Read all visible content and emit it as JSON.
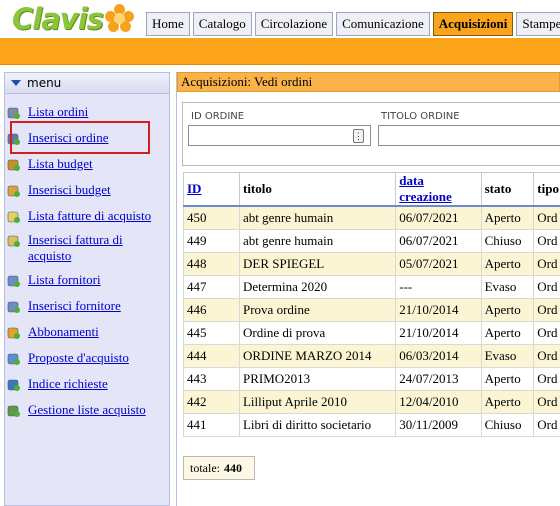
{
  "app": {
    "logo_text": "Clavis"
  },
  "topnav": {
    "tabs": [
      {
        "label": "Home",
        "active": false
      },
      {
        "label": "Catalogo",
        "active": false
      },
      {
        "label": "Circolazione",
        "active": false
      },
      {
        "label": "Comunicazione",
        "active": false
      },
      {
        "label": "Acquisizioni",
        "active": true
      },
      {
        "label": "Stampe",
        "active": false
      }
    ]
  },
  "sidebar": {
    "title": "menu",
    "items": [
      {
        "label": "Lista ordini",
        "icon": "order-list-icon"
      },
      {
        "label": "Inserisci ordine",
        "icon": "add-order-icon"
      },
      {
        "label": "Lista budget",
        "icon": "budget-bag-icon"
      },
      {
        "label": "Inserisci budget",
        "icon": "add-budget-icon"
      },
      {
        "label": "Lista fatture di acquisto",
        "icon": "invoice-list-icon"
      },
      {
        "label": "Inserisci fattura di acquisto",
        "icon": "add-invoice-icon"
      },
      {
        "label": "Lista fornitori",
        "icon": "suppliers-icon"
      },
      {
        "label": "Inserisci fornitore",
        "icon": "add-supplier-icon"
      },
      {
        "label": "Abbonamenti",
        "icon": "subscription-box-icon"
      },
      {
        "label": "Proposte d'acquisto",
        "icon": "purchase-proposal-icon"
      },
      {
        "label": "Indice richieste",
        "icon": "requests-chart-icon"
      },
      {
        "label": "Gestione liste acquisto",
        "icon": "purchase-lists-icon"
      }
    ]
  },
  "main": {
    "title": "Acquisizioni: Vedi ordini",
    "filters": {
      "id_label": "ID ORDINE",
      "id_value": "",
      "title_label": "TITOLO ORDINE",
      "title_value": ""
    },
    "table": {
      "columns": [
        "ID",
        "titolo",
        "data creazione",
        "stato",
        "tipo"
      ],
      "rows": [
        [
          "450",
          "abt genre humain",
          "06/07/2021",
          "Aperto",
          "Ord"
        ],
        [
          "449",
          "abt genre humain",
          "06/07/2021",
          "Chiuso",
          "Ord"
        ],
        [
          "448",
          "DER SPIEGEL",
          "05/07/2021",
          "Aperto",
          "Ord"
        ],
        [
          "447",
          "Determina 2020",
          "---",
          "Evaso",
          "Ord"
        ],
        [
          "446",
          "Prova ordine",
          "21/10/2014",
          "Aperto",
          "Ord"
        ],
        [
          "445",
          "Ordine di prova",
          "21/10/2014",
          "Aperto",
          "Ord"
        ],
        [
          "444",
          "ORDINE MARZO 2014",
          "06/03/2014",
          "Evaso",
          "Ord"
        ],
        [
          "443",
          "PRIMO2013",
          "24/07/2013",
          "Aperto",
          "Ord"
        ],
        [
          "442",
          "Lilliput Aprile 2010",
          "12/04/2010",
          "Aperto",
          "Ord"
        ],
        [
          "441",
          "Libri di diritto societario",
          "30/11/2009",
          "Chiuso",
          "Ord"
        ]
      ]
    },
    "total_label": "totale:",
    "total_value": "440"
  },
  "colors": {
    "accent_orange": "#fba41a",
    "link_blue": "#0000cc",
    "sidebar_bg": "#e4e6f8",
    "highlight_red": "#d21e1e"
  }
}
